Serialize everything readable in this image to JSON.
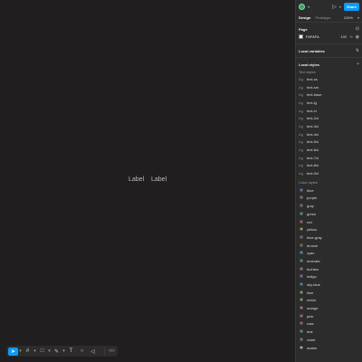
{
  "canvas": {
    "labels": [
      "Label",
      "Label"
    ]
  },
  "toolbar": {
    "tools": [
      {
        "name": "move-tool",
        "glyph": "➤",
        "active": true
      },
      {
        "name": "frame-tool",
        "glyph": "#",
        "active": false
      },
      {
        "name": "shape-tool",
        "glyph": "□",
        "active": false
      },
      {
        "name": "pen-tool",
        "glyph": "✎",
        "active": false
      },
      {
        "name": "text-tool",
        "glyph": "T",
        "active": false
      },
      {
        "name": "comment-tool",
        "glyph": "○",
        "active": false
      },
      {
        "name": "actions-tool",
        "glyph": "◁",
        "active": false
      }
    ],
    "code_label": "</>"
  },
  "panel": {
    "share_label": "Share",
    "tabs": [
      "Design",
      "Prototype"
    ],
    "zoom": "134%",
    "page": {
      "title": "Page",
      "color_hex": "FAFAFA",
      "opacity": "100",
      "opacity_unit": "%"
    },
    "local_variables": "Local variables",
    "local_styles": "Local styles",
    "text_styles_title": "Text styles",
    "text_styles": [
      "text-xs",
      "text-sm",
      "text-base",
      "text-lg",
      "text-xl",
      "text-2xl",
      "text-3xl",
      "text-4xl",
      "text-5xl",
      "text-6xl",
      "text-7xl",
      "text-8xl",
      "text-9xl"
    ],
    "color_styles_title": "Color styles",
    "color_styles": [
      {
        "name": "blue",
        "color": "#3b82f6"
      },
      {
        "name": "purple",
        "color": "#a855f7"
      },
      {
        "name": "gray",
        "color": "#6b7280"
      },
      {
        "name": "green",
        "color": "#22c55e"
      },
      {
        "name": "red",
        "color": "#ef4444"
      },
      {
        "name": "yellow",
        "color": "#eab308"
      },
      {
        "name": "blue-gray",
        "color": "#64748b"
      },
      {
        "name": "bronze",
        "color": "#a16207"
      },
      {
        "name": "cyan",
        "color": "#06b6d4"
      },
      {
        "name": "emerald",
        "color": "#10b981"
      },
      {
        "name": "fuchsia",
        "color": "#d946ef"
      },
      {
        "name": "indigo",
        "color": "#6366f1"
      },
      {
        "name": "sky-blue",
        "color": "#0ea5e9"
      },
      {
        "name": "lime",
        "color": "#84cc16"
      },
      {
        "name": "metal",
        "color": "#9ca3af"
      },
      {
        "name": "orange",
        "color": "#f97316"
      },
      {
        "name": "pink",
        "color": "#ec4899"
      },
      {
        "name": "rose",
        "color": "#f43f5e"
      },
      {
        "name": "teal",
        "color": "#14b8a6"
      },
      {
        "name": "violet",
        "color": "#8b5cf6"
      },
      {
        "name": "avatar",
        "color": "#d4d4d4"
      }
    ],
    "colors": {
      "accent": "#0d99ff",
      "canvas_bg": "#201e1f",
      "panel_bg": "#2c2c2c"
    }
  }
}
